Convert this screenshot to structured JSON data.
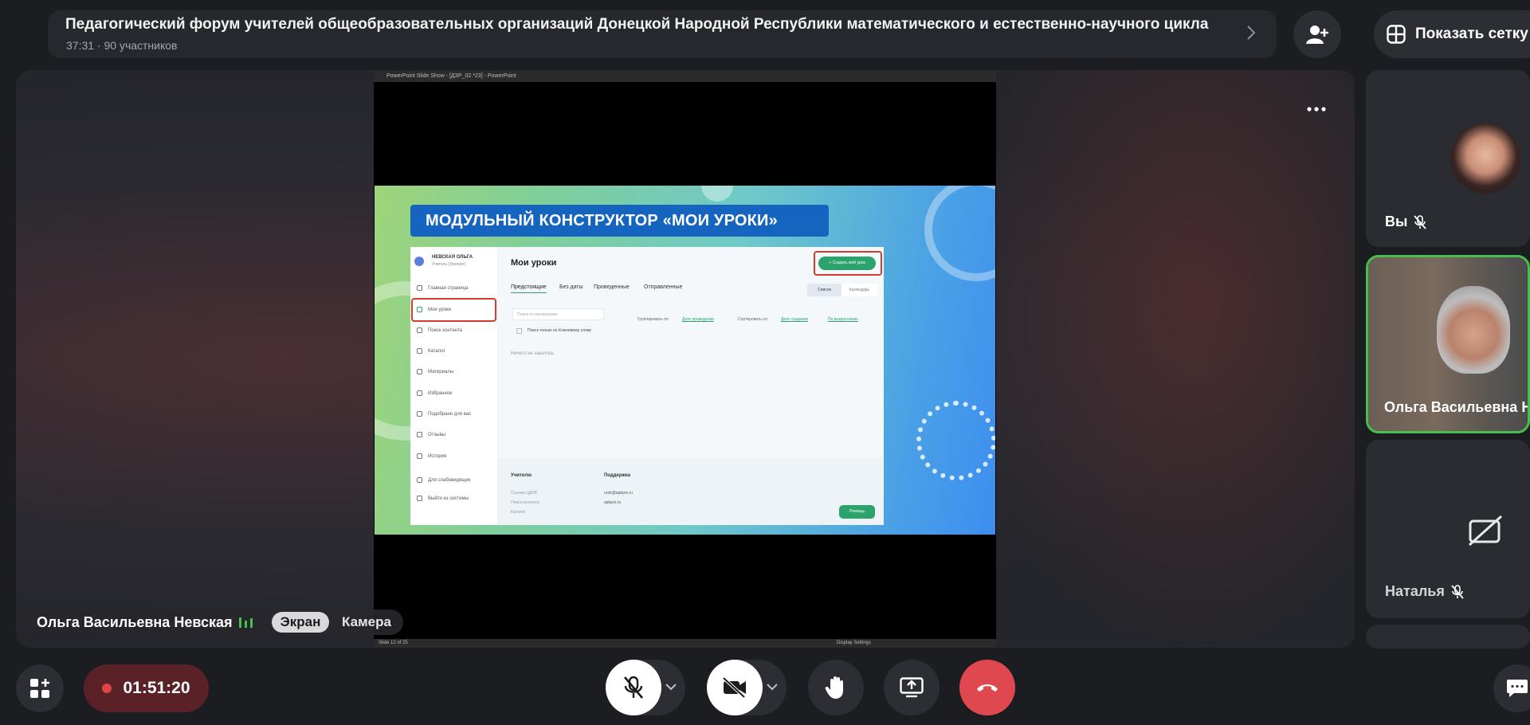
{
  "header": {
    "title": "Педагогический форум учителей общеобразовательных организаций Донецкой Народной Республики математического и естественно-научного цикла",
    "subtitle": "37:31 · 90 участников",
    "grid_button_label": "Показать сетку"
  },
  "stage": {
    "speaker_name": "Ольга Васильевна Невская",
    "source_options": [
      "Экран",
      "Камера"
    ],
    "selected_source": "Экран"
  },
  "shared_window": {
    "title": "PowerPoint Slide Show - [ДЗР_02.*23] - PowerPoint",
    "status_left": "Slide 12 of 25",
    "status_right": "Display Settings"
  },
  "slide": {
    "banner": "МОДУЛЬНЫЙ КОНСТРУКТОР «МОИ УРОКИ»",
    "app": {
      "user_name": "НЕВСКАЯ ОЛЬГА",
      "user_role": "Учитель (Эксперт)",
      "page_title": "Мои уроки",
      "create_button": "+ Создать мой урок",
      "tabs": [
        "Предстоящие",
        "Без даты",
        "Проведенные",
        "Отправленные"
      ],
      "view_toggle": [
        "Список",
        "Календарь"
      ],
      "search_placeholder": "Поиск по материалам",
      "group_by_label": "Группировать по:",
      "group_by_value": "Дате проведения",
      "sort_label": "Сортировать по:",
      "sort_value": "Дате создания",
      "sort_order": "По возрастанию",
      "keyword_checkbox": "Поиск только по Ключевому слову",
      "empty_text": "Ничего не нашлось",
      "sidebar": [
        "Главная страница",
        "Мои уроки",
        "Поиск контента",
        "Каталог",
        "Материалы",
        "Избранное",
        "Подобрано для вас",
        "Отзывы",
        "История",
        "Для слабовидящих",
        "Выйти из системы"
      ],
      "footer": {
        "col1_title": "Учителю",
        "col1_items": [
          "Ссылка ЦДОК",
          "Поиск контента",
          "Каталог"
        ],
        "col2_title": "Поддержка",
        "col2_items": [
          "urok@apkpro.ru",
          "apkpro.ru"
        ],
        "help_button": "Помощь"
      }
    }
  },
  "participants": [
    {
      "name": "Вы",
      "mic": "muted"
    },
    {
      "name": "Ольга Васильевна Невская",
      "active": true
    },
    {
      "name": "Наталья",
      "mic": "muted"
    }
  ],
  "controls": {
    "recording_time": "01:51:20"
  },
  "colors": {
    "accent_green": "#45c04f",
    "end_call": "#e0484f",
    "recording": "#5a2226"
  }
}
